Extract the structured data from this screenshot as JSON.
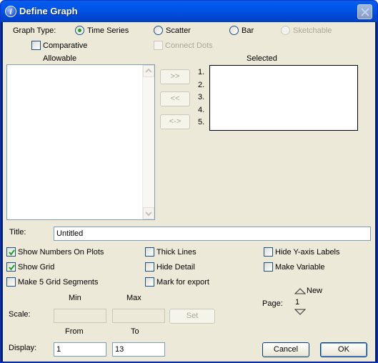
{
  "window": {
    "title": "Define Graph",
    "info_icon_glyph": "i"
  },
  "graph_type": {
    "label": "Graph Type:",
    "options": [
      {
        "label": "Time Series",
        "checked": true,
        "enabled": true
      },
      {
        "label": "Scatter",
        "checked": false,
        "enabled": true
      },
      {
        "label": "Bar",
        "checked": false,
        "enabled": true
      },
      {
        "label": "Sketchable",
        "checked": false,
        "enabled": false
      }
    ]
  },
  "comparative": {
    "label": "Comparative",
    "checked": false
  },
  "connect_dots": {
    "label": "Connect Dots",
    "checked": false,
    "enabled": false
  },
  "allowable": {
    "label": "Allowable",
    "items": []
  },
  "selected": {
    "label": "Selected",
    "numbers": [
      "1.",
      "2.",
      "3.",
      "4.",
      "5."
    ],
    "items": []
  },
  "transfer_buttons": {
    "add": ">>",
    "remove": "<<",
    "swap": "<->"
  },
  "title_field": {
    "label": "Title:",
    "value": "Untitled"
  },
  "options": {
    "show_numbers": {
      "label": "Show Numbers On Plots",
      "checked": true
    },
    "show_grid": {
      "label": "Show Grid",
      "checked": true
    },
    "five_grid": {
      "label": "Make 5 Grid Segments",
      "checked": false
    },
    "thick_lines": {
      "label": "Thick Lines",
      "checked": false
    },
    "hide_detail": {
      "label": "Hide Detail",
      "checked": false
    },
    "mark_export": {
      "label": "Mark for export",
      "checked": false
    },
    "hide_y_labels": {
      "label": "Hide Y-axis Labels",
      "checked": false
    },
    "make_variable": {
      "label": "Make Variable",
      "checked": false
    }
  },
  "scale": {
    "label": "Scale:",
    "min_label": "Min",
    "max_label": "Max",
    "min_value": "",
    "max_value": "",
    "set_label": "Set"
  },
  "display": {
    "label": "Display:",
    "from_label": "From",
    "to_label": "To",
    "from_value": "1",
    "to_value": "13"
  },
  "page": {
    "label": "Page:",
    "new_label": "New",
    "value": "1"
  },
  "buttons": {
    "cancel": "Cancel",
    "ok": "OK"
  }
}
